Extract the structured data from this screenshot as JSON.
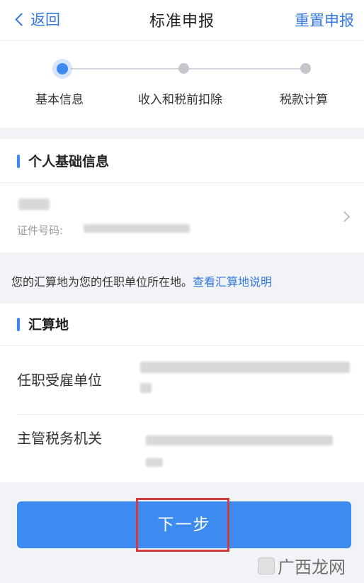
{
  "nav": {
    "back_label": "返回",
    "title": "标准申报",
    "reset_label": "重置申报"
  },
  "steps": [
    {
      "label": "基本信息",
      "state": "active"
    },
    {
      "label": "收入和税前扣除",
      "state": "pending"
    },
    {
      "label": "税款计算",
      "state": "pending"
    }
  ],
  "personal": {
    "section_title": "个人基础信息",
    "id_label": "证件号码:"
  },
  "notice": {
    "text": "您的汇算地为您的任职单位所在地。",
    "link": "查看汇算地说明"
  },
  "filing_place": {
    "section_title": "汇算地",
    "employer_label": "任职受雇单位",
    "tax_office_label": "主管税务机关"
  },
  "next_button": "下一步",
  "watermark": "广西龙网",
  "colors": {
    "accent": "#3d8af0",
    "link": "#3478e0",
    "highlight": "#d63a3a"
  }
}
